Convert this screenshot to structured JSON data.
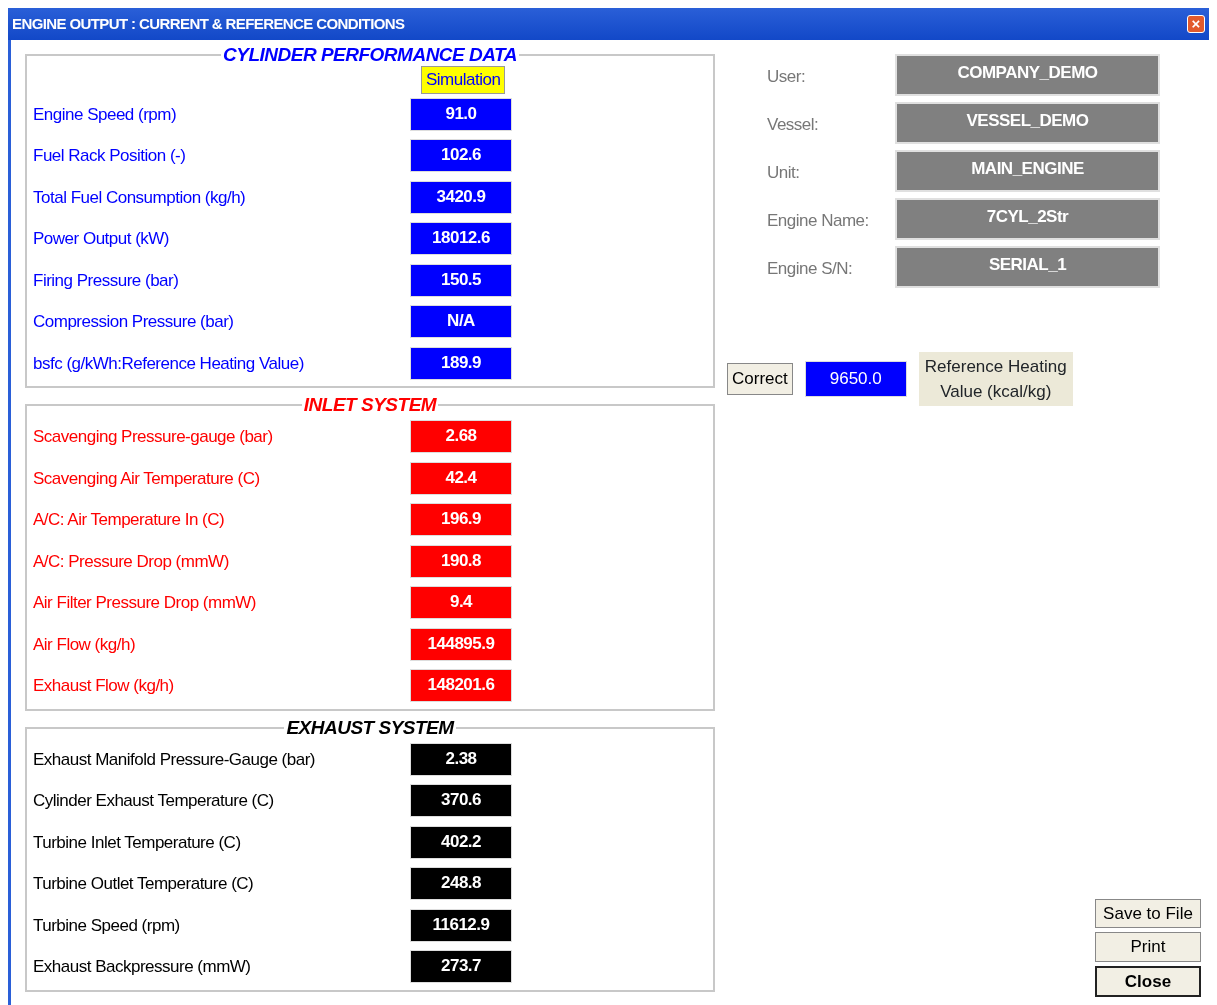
{
  "window": {
    "title": "ENGINE OUTPUT : CURRENT & REFERENCE CONDITIONS",
    "close": "×"
  },
  "sections": [
    {
      "title": "CYLINDER PERFORMANCE DATA",
      "color": "#0000ff",
      "header": "Simulation",
      "rows": [
        {
          "label": "Engine Speed (rpm)",
          "value": "91.0"
        },
        {
          "label": "Fuel Rack Position (-)",
          "value": "102.6"
        },
        {
          "label": "Total Fuel Consumption (kg/h)",
          "value": "3420.9"
        },
        {
          "label": "Power Output (kW)",
          "value": "18012.6"
        },
        {
          "label": "Firing Pressure (bar)",
          "value": "150.5"
        },
        {
          "label": "Compression Pressure (bar)",
          "value": "N/A"
        },
        {
          "label": "bsfc (g/kWh:Reference Heating Value)",
          "value": "189.9"
        }
      ]
    },
    {
      "title": "INLET SYSTEM",
      "color": "#ff0000",
      "rows": [
        {
          "label": "Scavenging Pressure-gauge (bar)",
          "value": "2.68"
        },
        {
          "label": "Scavenging Air Temperature (C)",
          "value": "42.4"
        },
        {
          "label": "A/C: Air Temperature In (C)",
          "value": "196.9"
        },
        {
          "label": "A/C: Pressure Drop (mmW)",
          "value": "190.8"
        },
        {
          "label": "Air Filter Pressure Drop (mmW)",
          "value": "9.4"
        },
        {
          "label": "Air Flow (kg/h)",
          "value": "144895.9"
        },
        {
          "label": "Exhaust Flow (kg/h)",
          "value": "148201.6"
        }
      ]
    },
    {
      "title": "EXHAUST SYSTEM",
      "color": "#000000",
      "rows": [
        {
          "label": "Exhaust Manifold Pressure-Gauge (bar)",
          "value": "2.38"
        },
        {
          "label": "Cylinder Exhaust Temperature (C)",
          "value": "370.6"
        },
        {
          "label": "Turbine Inlet Temperature (C)",
          "value": "402.2"
        },
        {
          "label": "Turbine Outlet Temperature (C)",
          "value": "248.8"
        },
        {
          "label": "Turbine Speed (rpm)",
          "value": "11612.9"
        },
        {
          "label": "Exhaust Backpressure (mmW)",
          "value": "273.7"
        }
      ]
    }
  ],
  "info": [
    {
      "label": "User:",
      "value": "COMPANY_DEMO"
    },
    {
      "label": "Vessel:",
      "value": "VESSEL_DEMO"
    },
    {
      "label": "Unit:",
      "value": "MAIN_ENGINE"
    },
    {
      "label": "Engine Name:",
      "value": "7CYL_2Str"
    },
    {
      "label": "Engine S/N:",
      "value": "SERIAL_1"
    }
  ],
  "heating": {
    "button": "Correct",
    "value": "9650.0",
    "label": "Reference Heating Value (kcal/kg)"
  },
  "buttons": [
    {
      "label": "Save to File",
      "default": false
    },
    {
      "label": "Print",
      "default": false
    },
    {
      "label": "Close",
      "default": true
    }
  ]
}
